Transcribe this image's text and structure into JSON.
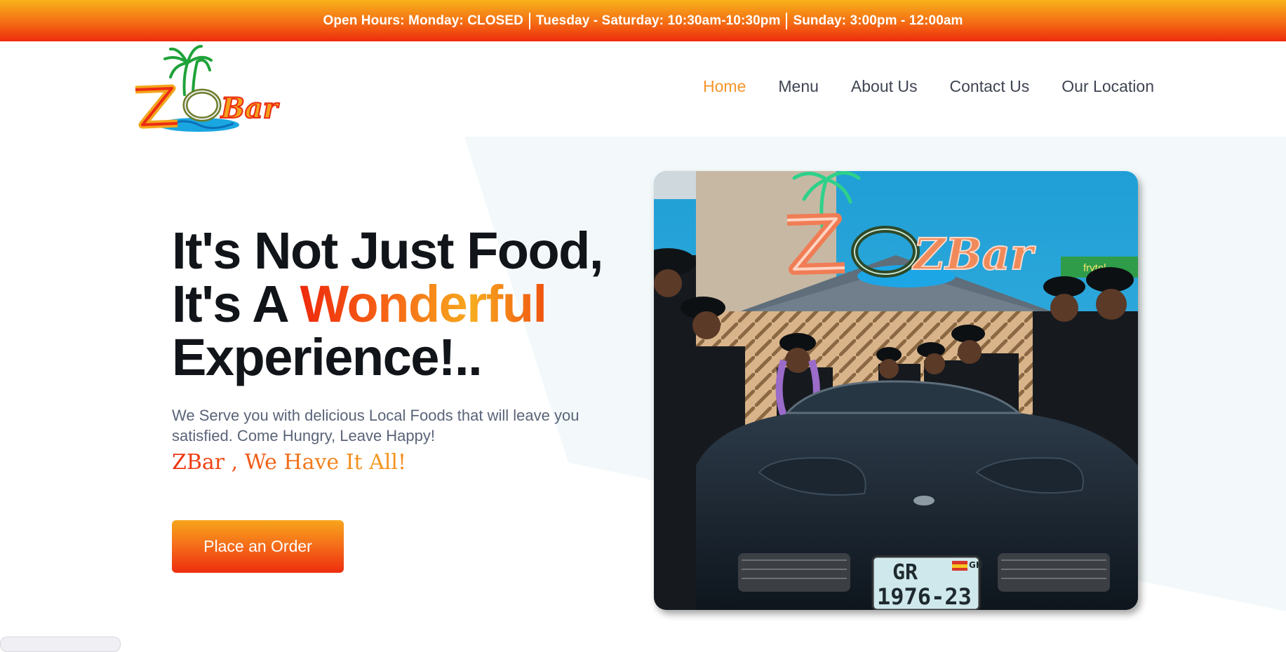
{
  "topbar": {
    "hours_label": "Open Hours:",
    "monday": "Monday: CLOSED",
    "tue_sat": "Tuesday - Saturday: 10:30am-10:30pm",
    "sunday": "Sunday: 3:00pm - 12:00am"
  },
  "brand": {
    "logo_text": "ZBar"
  },
  "nav": {
    "items": [
      {
        "label": "Home",
        "active": true
      },
      {
        "label": "Menu"
      },
      {
        "label": "About Us"
      },
      {
        "label": "Contact Us"
      },
      {
        "label": "Our Location"
      }
    ]
  },
  "hero": {
    "line1": "It's Not Just Food,",
    "line2_prefix": "It's A",
    "line2_highlight": "Wonderful",
    "line3": "Experience!..",
    "subtitle": "We Serve you with delicious Local Foods that will leave you satisfied. Come Hungry, Leave Happy!",
    "tagline": "ZBar , We Have It All!",
    "cta_label": "Place an Order"
  },
  "photo": {
    "sign_text": "ZBar",
    "plate_top": "GR",
    "plate_country": "GH",
    "plate_bottom": "1976-23",
    "shop_sign": "frytol"
  },
  "colors": {
    "accent_orange": "#f7942c",
    "gradient_red": "#ee2a0c",
    "gradient_yellow": "#f7ab1e",
    "nav_text": "#3f4452",
    "heading": "#111419"
  }
}
